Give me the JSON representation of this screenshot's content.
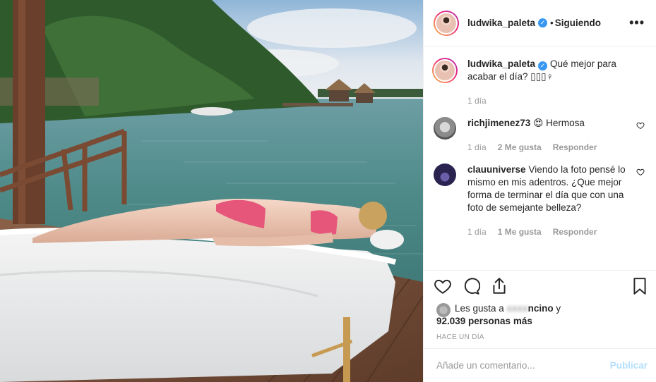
{
  "post": {
    "author": "ludwika_paleta",
    "verified_glyph": "✓",
    "separator": "•",
    "follow_status": "Siguiendo",
    "more_label": "•••",
    "caption": {
      "user": "ludwika_paleta",
      "text": "Qué mejor para acabar el día? ▯▯▯♀",
      "time": "1 día"
    },
    "comments": [
      {
        "user": "richjimenez73",
        "text": "😍 Hermosa",
        "time": "1 día",
        "likes": "2 Me gusta",
        "reply": "Responder"
      },
      {
        "user": "clauuniverse",
        "text": "Viendo la foto pensé lo mismo en mis adentros. ¿Que mejor forma de terminar el día que con una foto de semejante belleza?",
        "time": "1 día",
        "likes": "1 Me gusta",
        "reply": "Responder"
      }
    ],
    "likes_line1_prefix": "Les gusta a ",
    "likes_user_blurred": "xxxx",
    "likes_user_suffix": "ncino",
    "likes_line1_end": " y",
    "likes_line2": "92.039 personas más",
    "posted_ago": "HACE UN DÍA",
    "add_comment_placeholder": "Añade un comentario...",
    "publish_label": "Publicar"
  },
  "icons": {
    "like": "heart-icon",
    "comment": "comment-bubble-icon",
    "share": "share-icon",
    "save": "bookmark-icon",
    "options": "more-options-icon"
  },
  "colors": {
    "verified": "#3897f0",
    "publish_disabled": "#b2dffc",
    "meta_text": "#999999",
    "divider": "#efefef"
  }
}
